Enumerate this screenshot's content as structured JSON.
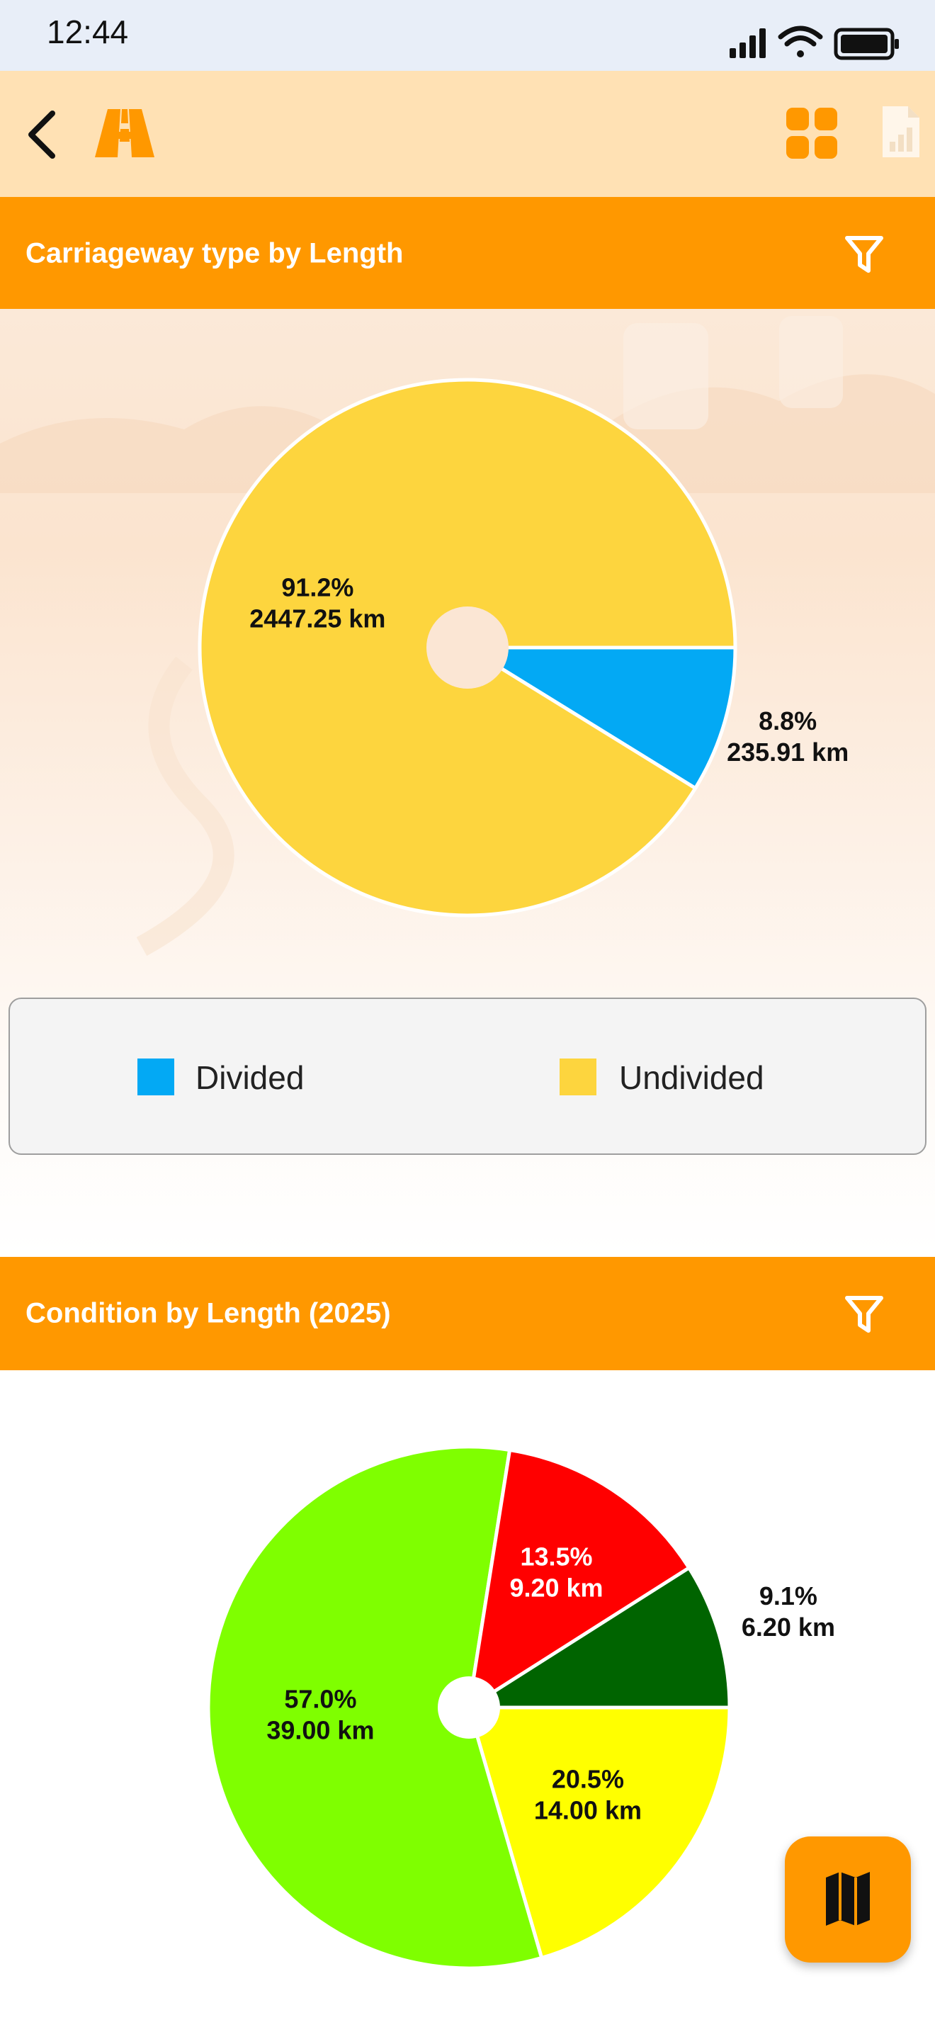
{
  "status_bar": {
    "time": "12:44"
  },
  "header": {
    "back_icon": "chevron-left-icon",
    "logo_icon": "road-icon",
    "grid_icon": "grid-icon",
    "report_icon": "report-chart-icon"
  },
  "colors": {
    "accent": "#ff9800",
    "header_bg": "#ffe1b4"
  },
  "section1": {
    "title": "Carriageway type by Length",
    "filter_icon": "filter-icon"
  },
  "section2": {
    "title": "Condition by Length (2025)",
    "filter_icon": "filter-icon"
  },
  "legend1": {
    "items": [
      {
        "label": "Divided",
        "color": "#03a9f4"
      },
      {
        "label": "Undivided",
        "color": "#fdd53e"
      }
    ]
  },
  "fab": {
    "icon": "map-icon"
  },
  "chart_data": [
    {
      "type": "pie",
      "title": "Carriageway type by Length",
      "slices": [
        {
          "label": "Divided",
          "percent": 8.8,
          "value": 235.91,
          "unit": "km",
          "color": "#03a9f4",
          "pct_text": "8.8%",
          "val_text": "235.91 km"
        },
        {
          "label": "Undivided",
          "percent": 91.2,
          "value": 2447.25,
          "unit": "km",
          "color": "#fdd53e",
          "pct_text": "91.2%",
          "val_text": "2447.25 km"
        }
      ],
      "legend": "bottom"
    },
    {
      "type": "pie",
      "title": "Condition by Length (2025)",
      "slices": [
        {
          "percent": 9.1,
          "value": 6.2,
          "unit": "km",
          "color": "#006400",
          "pct_text": "9.1%",
          "val_text": "6.20 km"
        },
        {
          "percent": 20.5,
          "value": 14.0,
          "unit": "km",
          "color": "#ffff00",
          "pct_text": "20.5%",
          "val_text": "14.00 km"
        },
        {
          "percent": 57.0,
          "value": 39.0,
          "unit": "km",
          "color": "#7fff00",
          "pct_text": "57.0%",
          "val_text": "39.00 km"
        },
        {
          "percent": 13.5,
          "value": 9.2,
          "unit": "km",
          "color": "#ff0000",
          "pct_text": "13.5%",
          "val_text": "9.20 km"
        }
      ]
    }
  ]
}
